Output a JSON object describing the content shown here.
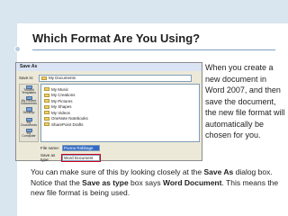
{
  "slide": {
    "title": "Which Format Are You Using?",
    "right_text": "When you create a new document in Word 2007, and then save the document, the new file format will automatically be chosen for you.",
    "bottom": {
      "t1": "You can make sure of this by looking closely at the ",
      "b1": "Save As",
      "t2": " dialog box. Notice that the ",
      "b2": "Save as type",
      "t3": " box says ",
      "b3": "Word Document",
      "t4": ". This means the new file format is being used."
    }
  },
  "dialog": {
    "title": "Save As",
    "save_in_label": "Save in:",
    "save_in_value": "My Documents",
    "places": [
      "Trusted Templates",
      "My Recent Documents",
      "Desktop",
      "My Documents",
      "My Computer"
    ],
    "files": [
      "My Music",
      "My Creations",
      "My Pictures",
      "My Shapes",
      "My Videos",
      "OneNote Notebooks",
      "SharePoint Drafts"
    ],
    "file_name_label": "File name:",
    "file_name_value": "Poona Rabbage",
    "save_type_label": "Save as type:",
    "save_type_value": "Word Document"
  },
  "colors": {
    "accent_bar": "#d9e5ef",
    "title_rule": "#7f9fc0",
    "highlight": "#d0021b"
  }
}
